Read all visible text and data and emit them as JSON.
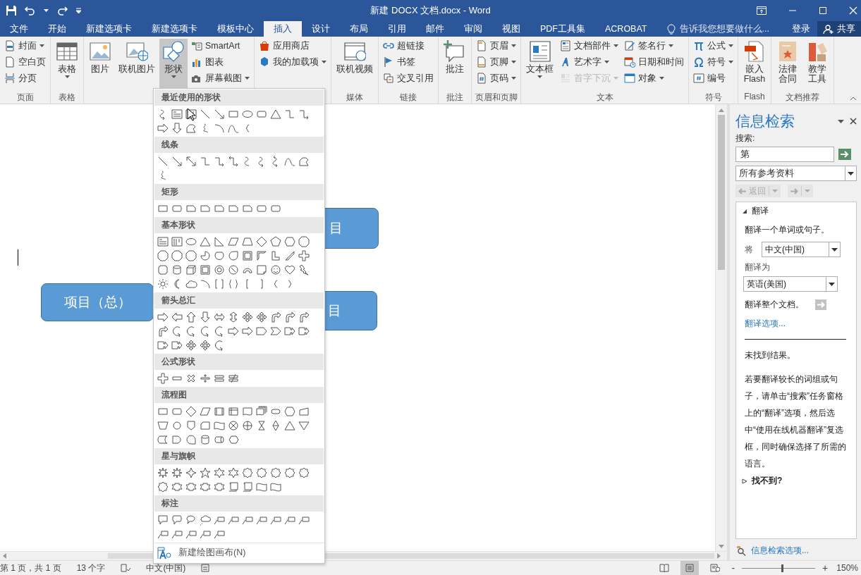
{
  "title_bar": {
    "title": "新建 DOCX 文档.docx - Word"
  },
  "tabs": [
    {
      "label": "文件",
      "selected": false
    },
    {
      "label": "开始",
      "selected": false
    },
    {
      "label": "新建选项卡",
      "selected": false
    },
    {
      "label": "新建选项卡",
      "selected": false
    },
    {
      "label": "模板中心",
      "selected": false
    },
    {
      "label": "插入",
      "selected": true
    },
    {
      "label": "设计",
      "selected": false
    },
    {
      "label": "布局",
      "selected": false
    },
    {
      "label": "引用",
      "selected": false
    },
    {
      "label": "邮件",
      "selected": false
    },
    {
      "label": "审阅",
      "selected": false
    },
    {
      "label": "视图",
      "selected": false
    },
    {
      "label": "PDF工具集",
      "selected": false
    },
    {
      "label": "ACROBAT",
      "selected": false
    }
  ],
  "tell_me": {
    "placeholder": "告诉我您想要做什么..."
  },
  "sign_in": "登录",
  "share": "共享",
  "ribbon": {
    "groups": [
      {
        "label": "页面",
        "columns": [
          [
            {
              "label": "封面",
              "kind": "small",
              "caret": true,
              "pressed": false,
              "disabled": false
            },
            {
              "label": "空白页",
              "kind": "small",
              "caret": false,
              "pressed": false,
              "disabled": false
            },
            {
              "label": "分页",
              "kind": "small",
              "caret": false,
              "pressed": false,
              "disabled": false
            }
          ]
        ]
      },
      {
        "label": "表格",
        "columns": [
          [
            {
              "label": "表格",
              "kind": "large",
              "caret": true,
              "pressed": false,
              "disabled": false
            }
          ]
        ]
      },
      {
        "columns": [
          [
            {
              "label": "图片",
              "kind": "large",
              "caret": false,
              "pressed": false,
              "disabled": false
            }
          ],
          [
            {
              "label": "联机图片",
              "kind": "large",
              "caret": false,
              "pressed": false,
              "disabled": false
            }
          ],
          [
            {
              "label": "形状",
              "kind": "large",
              "caret": true,
              "pressed": true,
              "disabled": false
            }
          ],
          [
            {
              "label": "SmartArt",
              "kind": "small",
              "caret": false,
              "pressed": false,
              "disabled": false
            },
            {
              "label": "图表",
              "kind": "small",
              "caret": false,
              "pressed": false,
              "disabled": false
            },
            {
              "label": "屏幕截图",
              "kind": "small",
              "caret": true,
              "pressed": false,
              "disabled": false
            }
          ]
        ]
      },
      {
        "columns": [
          [
            {
              "label": "应用商店",
              "kind": "small",
              "caret": false,
              "pressed": false,
              "disabled": false
            },
            {
              "label": "我的加载项",
              "kind": "small",
              "caret": true,
              "pressed": false,
              "disabled": false
            }
          ]
        ]
      },
      {
        "label": "媒体",
        "columns": [
          [
            {
              "label": "联机视频",
              "kind": "large",
              "caret": false,
              "pressed": false,
              "disabled": false
            }
          ]
        ]
      },
      {
        "label": "链接",
        "columns": [
          [
            {
              "label": "超链接",
              "kind": "small",
              "caret": false,
              "pressed": false,
              "disabled": false
            },
            {
              "label": "书签",
              "kind": "small",
              "caret": false,
              "pressed": false,
              "disabled": false
            },
            {
              "label": "交叉引用",
              "kind": "small",
              "caret": false,
              "pressed": false,
              "disabled": false
            }
          ]
        ]
      },
      {
        "label": "批注",
        "columns": [
          [
            {
              "label": "批注",
              "kind": "large",
              "caret": false,
              "pressed": false,
              "disabled": false
            }
          ]
        ]
      },
      {
        "label": "页眉和页脚",
        "columns": [
          [
            {
              "label": "页眉",
              "kind": "small",
              "caret": true,
              "pressed": false,
              "disabled": false
            },
            {
              "label": "页脚",
              "kind": "small",
              "caret": true,
              "pressed": false,
              "disabled": false
            },
            {
              "label": "页码",
              "kind": "small",
              "caret": true,
              "pressed": false,
              "disabled": false
            }
          ]
        ]
      },
      {
        "label": "文本",
        "columns": [
          [
            {
              "label": "文本框",
              "kind": "large",
              "caret": true,
              "pressed": false,
              "disabled": false
            }
          ],
          [
            {
              "label": "文档部件",
              "kind": "small",
              "caret": true,
              "pressed": false,
              "disabled": false
            },
            {
              "label": "艺术字",
              "kind": "small",
              "caret": true,
              "pressed": false,
              "disabled": false
            },
            {
              "label": "首字下沉",
              "kind": "small",
              "caret": true,
              "pressed": false,
              "disabled": true
            }
          ],
          [
            {
              "label": "签名行",
              "kind": "small",
              "caret": true,
              "pressed": false,
              "disabled": false
            },
            {
              "label": "日期和时间",
              "kind": "small",
              "caret": false,
              "pressed": false,
              "disabled": false
            },
            {
              "label": "对象",
              "kind": "small",
              "caret": true,
              "pressed": false,
              "disabled": false
            }
          ]
        ]
      },
      {
        "label": "符号",
        "columns": [
          [
            {
              "label": "公式",
              "kind": "small",
              "caret": true,
              "pressed": false,
              "disabled": false
            },
            {
              "label": "符号",
              "kind": "small",
              "caret": true,
              "pressed": false,
              "disabled": false
            },
            {
              "label": "编号",
              "kind": "small",
              "caret": false,
              "pressed": false,
              "disabled": false
            }
          ]
        ]
      },
      {
        "label": "Flash",
        "columns": [
          [
            {
              "label": "嵌入\nFlash",
              "kind": "large",
              "caret": false,
              "pressed": false,
              "disabled": false
            }
          ]
        ]
      },
      {
        "label": "文档推荐",
        "columns": [
          [
            {
              "lines": [
                "法律",
                "合同"
              ],
              "kind": "large",
              "caret": false,
              "pressed": false,
              "disabled": false
            }
          ],
          [
            {
              "lines": [
                "教学",
                "工具"
              ],
              "kind": "large",
              "caret": false,
              "pressed": false,
              "disabled": false
            }
          ]
        ]
      }
    ]
  },
  "canvas": {
    "boxes": [
      {
        "text": "项目（总）"
      },
      {
        "text": "目"
      },
      {
        "text": "目"
      }
    ]
  },
  "shapes_menu": {
    "sections": [
      {
        "title": "最近使用的形状"
      },
      {
        "title": "线条"
      },
      {
        "title": "矩形"
      },
      {
        "title": "基本形状"
      },
      {
        "title": "箭头总汇"
      },
      {
        "title": "公式形状"
      },
      {
        "title": "流程图"
      },
      {
        "title": "星与旗帜"
      },
      {
        "title": "标注"
      }
    ],
    "new_canvas": "新建绘图画布(N)"
  },
  "research_pane": {
    "title": "信息检索",
    "search_label": "搜索:",
    "search_value": "第",
    "source": "所有参考资料",
    "back": "返回",
    "translate": {
      "title": "翻译",
      "expanded": true,
      "intro": "翻译一个单词或句子。",
      "from_label": "将",
      "from": "中文(中国)",
      "to_label": "翻译为",
      "to": "英语(美国)",
      "whole_doc": "翻译整个文档。",
      "options_link": "翻译选项..."
    },
    "no_results": "未找到结果。",
    "hint": "若要翻译较长的词组或句子，请单击“搜索”任务窗格上的“翻译”选项，然后选中“使用在线机器翻译”复选框，同时确保选择了所需的语言。",
    "not_found": {
      "title": "找不到?",
      "expanded": false
    },
    "options_link": "信息检索选项..."
  },
  "status_bar": {
    "page": "第 1 页，共 1 页",
    "words": "13 个字",
    "language": "中文(中国)",
    "views": [
      {
        "selected": false
      },
      {
        "selected": true
      },
      {
        "selected": false
      }
    ],
    "zoom_out": "-",
    "zoom_in": "+",
    "zoom": {
      "level": 0.55,
      "reading": "150%"
    }
  }
}
